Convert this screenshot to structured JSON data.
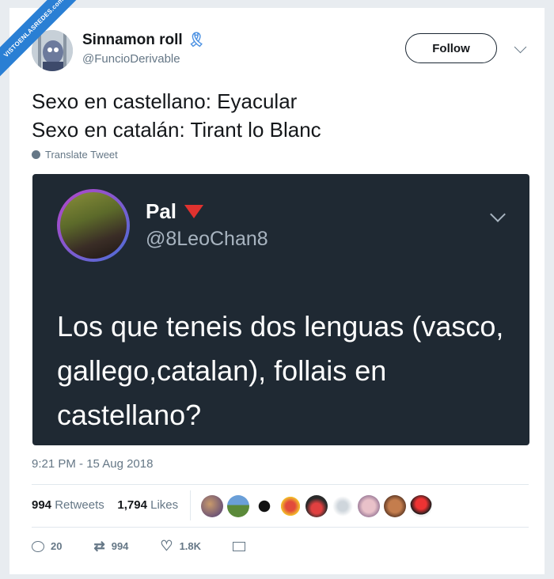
{
  "watermark": "VISTOENLASREDES.com",
  "author": {
    "name": "Sinnamon roll",
    "handle": "@FuncioDerivable"
  },
  "follow_label": "Follow",
  "tweet": {
    "line1": "Sexo en castellano: Eyacular",
    "line2": "Sexo en catalán: Tirant lo Blanc",
    "translate_label": "Translate Tweet"
  },
  "quoted": {
    "name": "Pal",
    "handle": "@8LeoChan8",
    "text": "Los que teneis dos lenguas (vasco, gallego,catalan), follais en castellano?"
  },
  "timestamp": "9:21 PM - 15 Aug 2018",
  "stats": {
    "retweets_count": "994",
    "retweets_label": "Retweets",
    "likes_count": "1,794",
    "likes_label": "Likes"
  },
  "actions": {
    "replies": "20",
    "retweets": "994",
    "likes": "1.8K"
  },
  "colors": {
    "quote_bg": "#1f2933",
    "ribbon": "#2a7fd4",
    "red_triangle": "#e0322f"
  },
  "icons": [
    "awareness-ribbon-icon",
    "chevron-down-icon",
    "globe-icon",
    "red-triangle-icon",
    "reply-icon",
    "retweet-icon",
    "like-icon",
    "message-icon"
  ]
}
